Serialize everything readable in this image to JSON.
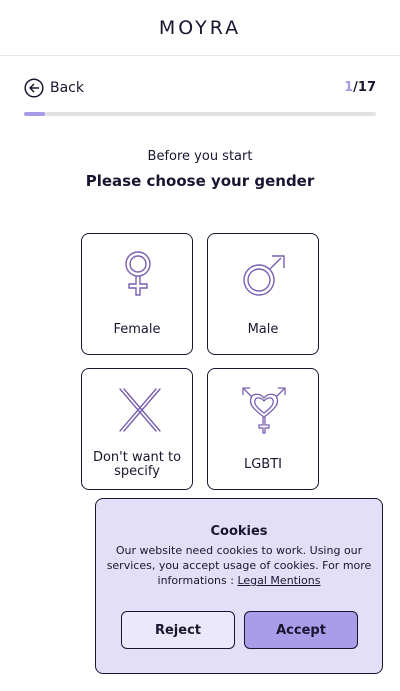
{
  "header": {
    "logo": "MOYRA"
  },
  "nav": {
    "back_label": "Back",
    "progress_current": "1",
    "progress_total": "/17",
    "progress_fraction": 0.0588
  },
  "intro": {
    "subtitle": "Before you start",
    "title": "Please choose your gender"
  },
  "options": [
    {
      "label": "Female",
      "icon": "female-symbol-icon"
    },
    {
      "label": "Male",
      "icon": "male-symbol-icon"
    },
    {
      "label": "Don't want to specify",
      "icon": "cross-icon"
    },
    {
      "label": "LGBTI",
      "icon": "transgender-heart-symbol-icon"
    }
  ],
  "cookie_banner": {
    "title": "Cookies",
    "text": "Our website need cookies to work. Using our services, you accept usage of cookies. For more informations :",
    "link_label": "Legal Mentions",
    "reject_label": "Reject",
    "accept_label": "Accept"
  },
  "colors": {
    "primary_dark": "#1b1530",
    "accent": "#a89ae6",
    "banner_bg": "#e3dff9"
  }
}
